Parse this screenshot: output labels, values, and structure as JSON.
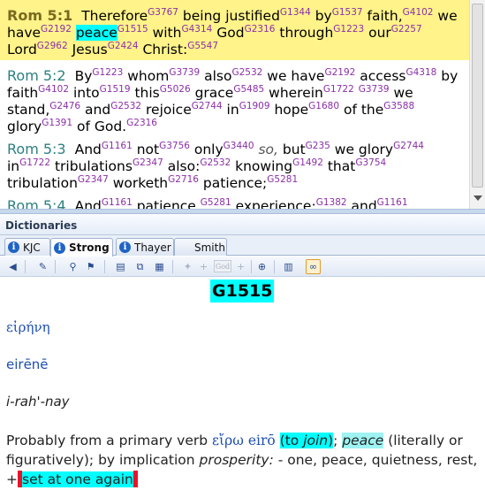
{
  "bible": {
    "verses": [
      {
        "ref": "Rom 5:1",
        "words": [
          {
            "w": "Therefore",
            "s": "G3767"
          },
          {
            "w": "being justified",
            "s": "G1344"
          },
          {
            "w": "by",
            "s": "G1537"
          },
          {
            "w": "faith,",
            "s": "G4102"
          },
          {
            "w": "we have",
            "s": "G2192"
          },
          {
            "w": "peace",
            "s": "G1515"
          },
          {
            "w": "with",
            "s": "G4314"
          },
          {
            "w": "God",
            "s": "G2316"
          },
          {
            "w": "through",
            "s": "G1223"
          },
          {
            "w": "our",
            "s": "G2257"
          },
          {
            "w": "Lord",
            "s": "G2962"
          },
          {
            "w": "Jesus",
            "s": "G2424"
          },
          {
            "w": "Christ:",
            "s": "G5547"
          }
        ]
      },
      {
        "ref": "Rom 5:2",
        "words": [
          {
            "w": "By",
            "s": "G1223"
          },
          {
            "w": "whom",
            "s": "G3739"
          },
          {
            "w": "also",
            "s": "G2532"
          },
          {
            "w": "we have",
            "s": "G2192"
          },
          {
            "w": "access",
            "s": "G4318"
          },
          {
            "w": "by faith",
            "s": "G4102"
          },
          {
            "w": "into",
            "s": "G1519"
          },
          {
            "w": "this",
            "s": "G5026"
          },
          {
            "w": "grace",
            "s": "G5485"
          },
          {
            "w": "wherein",
            "s": "G1722"
          },
          {
            "w": "",
            "s": "G3739"
          },
          {
            "w": "we stand,",
            "s": "G2476"
          },
          {
            "w": "and",
            "s": "G2532"
          },
          {
            "w": "rejoice",
            "s": "G2744"
          },
          {
            "w": "in",
            "s": "G1909"
          },
          {
            "w": "hope",
            "s": "G1680"
          },
          {
            "w": "of the",
            "s": "G3588"
          },
          {
            "w": "glory",
            "s": "G1391"
          },
          {
            "w": "of God.",
            "s": "G2316"
          }
        ]
      },
      {
        "ref": "Rom 5:3",
        "words": [
          {
            "w": "And",
            "s": "G1161"
          },
          {
            "w": "not",
            "s": "G3756"
          },
          {
            "w": "only",
            "s": "G3440"
          },
          {
            "w": "so,",
            "s": "",
            "italic": true
          },
          {
            "w": "but",
            "s": "G235"
          },
          {
            "w": "we glory",
            "s": "G2744"
          },
          {
            "w": "in",
            "s": "G1722"
          },
          {
            "w": "tribulations",
            "s": "G2347"
          },
          {
            "w": "also:",
            "s": "G2532"
          },
          {
            "w": "knowing",
            "s": "G1492"
          },
          {
            "w": "that",
            "s": "G3754"
          },
          {
            "w": "tribulation",
            "s": "G2347"
          },
          {
            "w": "worketh",
            "s": "G2716"
          },
          {
            "w": "patience;",
            "s": "G5281"
          }
        ]
      },
      {
        "ref": "Rom 5:4",
        "words": [
          {
            "w": "And",
            "s": "G1161"
          },
          {
            "w": "patience,",
            "s": "G5281"
          },
          {
            "w": "experience;",
            "s": "G1382"
          },
          {
            "w": "and",
            "s": "G1161"
          }
        ]
      }
    ]
  },
  "dictionaries": {
    "panel_title": "Dictionaries",
    "tabs": [
      "KJC",
      "Strong",
      "Thayer",
      "Smith"
    ],
    "active_tab": "Strong",
    "entry": {
      "number": "G1515",
      "greek": "εἰρήνη",
      "transliteration": "eirēnē",
      "pronunciation": "i-rah'-nay",
      "definition": {
        "part1": "Probably from a primary verb ",
        "greek": "εἴρω eirō",
        "gloss_open": "(to ",
        "gloss_word": "join",
        "gloss_close": ")",
        "part2": "; ",
        "peace": "peace",
        "part3": " (literally or figuratively); by implication ",
        "prosperity": "prosperity:",
        "part4": " - one, peace, quietness, rest, +",
        "set_at_one": "set at one again"
      }
    }
  },
  "colors": {
    "verse_highlight": "#fff38a",
    "selection": "#00ffff",
    "strongs_number": "#8b2fa8",
    "verse_ref": "#2d8080",
    "marker": "#e8132a"
  }
}
